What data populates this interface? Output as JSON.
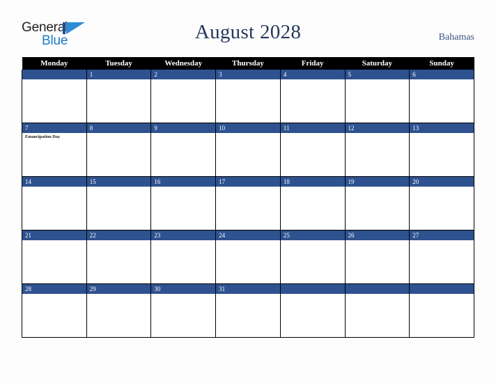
{
  "brand": {
    "name_part1": "General",
    "name_part2": "Blue",
    "mark": "triangle-logo",
    "colors": {
      "general_text": "#231f20",
      "blue_text": "#1c7cc4",
      "triangle": "#2e8bd4",
      "bar": "#1b4f8f"
    }
  },
  "header": {
    "title": "August 2028",
    "country": "Bahamas"
  },
  "theme": {
    "header_row_bg": "#000000",
    "date_band_bg": "#2e5290",
    "date_text": "#ffffff",
    "cell_bg": "#ffffff",
    "page_bg": "#fdfdfd",
    "title_color": "#24385e",
    "country_color": "#3c5580",
    "grid_border": "#000000"
  },
  "calendar": {
    "month": "August",
    "year": "2028",
    "weekday_headers": [
      "Monday",
      "Tuesday",
      "Wednesday",
      "Thursday",
      "Friday",
      "Saturday",
      "Sunday"
    ],
    "weeks": [
      [
        {
          "day": "",
          "events": []
        },
        {
          "day": "1",
          "events": []
        },
        {
          "day": "2",
          "events": []
        },
        {
          "day": "3",
          "events": []
        },
        {
          "day": "4",
          "events": []
        },
        {
          "day": "5",
          "events": []
        },
        {
          "day": "6",
          "events": []
        }
      ],
      [
        {
          "day": "7",
          "events": [
            "Emancipation Day"
          ]
        },
        {
          "day": "8",
          "events": []
        },
        {
          "day": "9",
          "events": []
        },
        {
          "day": "10",
          "events": []
        },
        {
          "day": "11",
          "events": []
        },
        {
          "day": "12",
          "events": []
        },
        {
          "day": "13",
          "events": []
        }
      ],
      [
        {
          "day": "14",
          "events": []
        },
        {
          "day": "15",
          "events": []
        },
        {
          "day": "16",
          "events": []
        },
        {
          "day": "17",
          "events": []
        },
        {
          "day": "18",
          "events": []
        },
        {
          "day": "19",
          "events": []
        },
        {
          "day": "20",
          "events": []
        }
      ],
      [
        {
          "day": "21",
          "events": []
        },
        {
          "day": "22",
          "events": []
        },
        {
          "day": "23",
          "events": []
        },
        {
          "day": "24",
          "events": []
        },
        {
          "day": "25",
          "events": []
        },
        {
          "day": "26",
          "events": []
        },
        {
          "day": "27",
          "events": []
        }
      ],
      [
        {
          "day": "28",
          "events": []
        },
        {
          "day": "29",
          "events": []
        },
        {
          "day": "30",
          "events": []
        },
        {
          "day": "31",
          "events": []
        },
        {
          "day": "",
          "events": []
        },
        {
          "day": "",
          "events": []
        },
        {
          "day": "",
          "events": []
        }
      ]
    ]
  }
}
